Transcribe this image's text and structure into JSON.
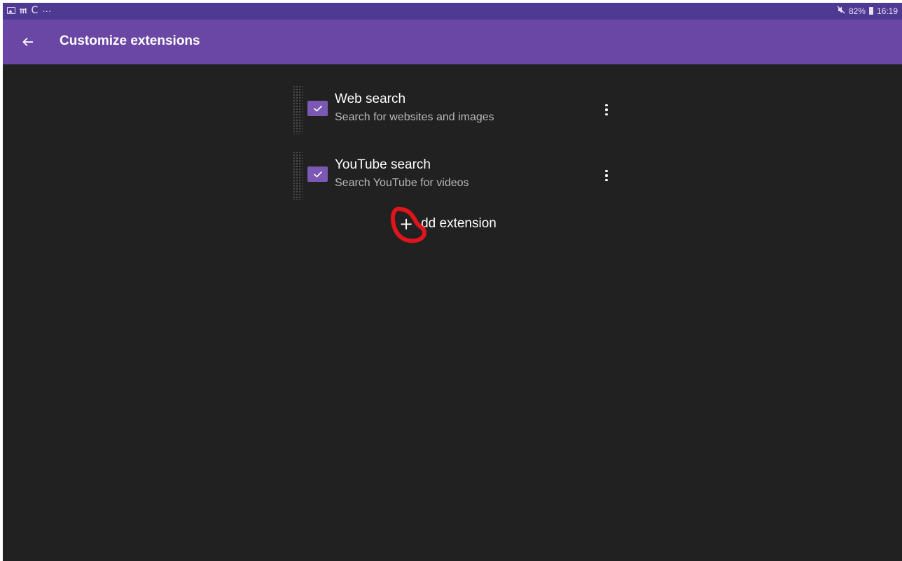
{
  "status_bar": {
    "left_icons": [
      "gallery-icon",
      "m-app-icon",
      "c-app-icon",
      "more-notifications-icon"
    ],
    "m_glyph": "𝔪",
    "c_glyph": "C",
    "dots": "···",
    "battery_percent": "82%",
    "time": "16:19"
  },
  "app_bar": {
    "title": "Customize extensions",
    "back_icon": "arrow-left-icon",
    "color": "#6a47a4"
  },
  "extensions": [
    {
      "title": "Web search",
      "subtitle": "Search for websites and images",
      "checked": true
    },
    {
      "title": "YouTube search",
      "subtitle": "Search YouTube for videos",
      "checked": true
    }
  ],
  "add_button": {
    "icon": "plus-icon",
    "plus": "+",
    "label": "dd extension"
  },
  "colors": {
    "background": "#212121",
    "accent": "#7c58b5",
    "status_bar": "#4e3a92",
    "annotation": "#e0141c"
  }
}
